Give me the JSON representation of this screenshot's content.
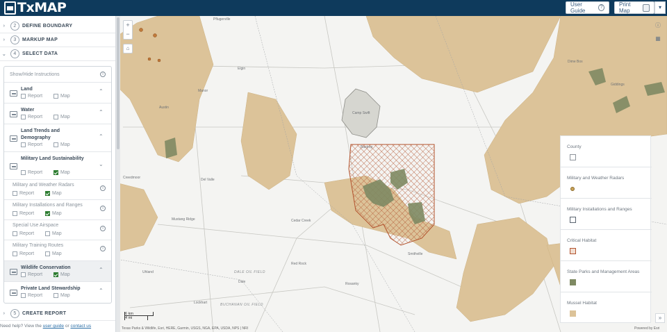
{
  "header": {
    "app_name": "TxMAP",
    "user_guide_label": "User Guide",
    "print_map_label": "Print Map",
    "help_icon_glyph": "?",
    "dropdown_glyph": "▾",
    "bg_color": "#0e3a5c"
  },
  "steps": [
    {
      "num": "2",
      "label": "DEFINE BOUNDARY",
      "chev": "›"
    },
    {
      "num": "3",
      "label": "MARKUP MAP",
      "chev": "›"
    },
    {
      "num": "4",
      "label": "SELECT DATA",
      "chev": "⌄"
    },
    {
      "num": "5",
      "label": "CREATE REPORT",
      "chev": "›"
    }
  ],
  "panel": {
    "instructions_label": "Show/Hide Instructions",
    "info_glyph": "i",
    "report_label": "Report",
    "map_label": "Map",
    "categories": [
      {
        "title": "Land",
        "report": false,
        "map": false,
        "chev": "⌃"
      },
      {
        "title": "Water",
        "report": false,
        "map": false,
        "chev": "⌃"
      },
      {
        "title": "Land Trends and Demography",
        "report": false,
        "map": false,
        "chev": "⌃"
      },
      {
        "title": "Military Land Sustainability",
        "report": false,
        "map": true,
        "chev": "⌄"
      },
      {
        "title": "Wildlife Conservation",
        "report": false,
        "map": true,
        "chev": "⌃"
      },
      {
        "title": "Private Land Stewardship",
        "report": false,
        "map": false,
        "chev": "⌃"
      }
    ],
    "sublayers": [
      {
        "title": "Military and Weather Radars",
        "report": false,
        "map": true
      },
      {
        "title": "Military Installations and Ranges",
        "report": false,
        "map": true
      },
      {
        "title": "Special Use Airspace",
        "report": false,
        "map": false
      },
      {
        "title": "Military Training Routes",
        "report": false,
        "map": false
      }
    ]
  },
  "help": {
    "prefix": "Need help? View the",
    "guide_link": "user guide",
    "or": "or",
    "contact_link": "contact us"
  },
  "map": {
    "zoom_in": "+",
    "zoom_out": "−",
    "home_icon": "⌂",
    "info_icon": "ⓘ",
    "grid_icon": "▦",
    "expand_icon": "»",
    "labels": [
      {
        "text": "Pflugerville",
        "cls": ""
      },
      {
        "text": "Elgin",
        "cls": ""
      },
      {
        "text": "Austin",
        "cls": ""
      },
      {
        "text": "Manor",
        "cls": ""
      },
      {
        "text": "Camp Swift",
        "cls": ""
      },
      {
        "text": "Dime Box",
        "cls": ""
      },
      {
        "text": "Giddings",
        "cls": ""
      },
      {
        "text": "Bastrop",
        "cls": ""
      },
      {
        "text": "Cedar Creek",
        "cls": ""
      },
      {
        "text": "Smithville",
        "cls": ""
      },
      {
        "text": "Red Rock",
        "cls": ""
      },
      {
        "text": "Lockhart",
        "cls": ""
      },
      {
        "text": "Dale",
        "cls": ""
      },
      {
        "text": "Rosanky",
        "cls": ""
      },
      {
        "text": "Mustang Ridge",
        "cls": ""
      },
      {
        "text": "DALE OIL FIELD",
        "cls": "it"
      },
      {
        "text": "BUCHANAN OIL FIELD",
        "cls": "it"
      },
      {
        "text": "Uhland",
        "cls": ""
      },
      {
        "text": "Del Valle",
        "cls": ""
      },
      {
        "text": "Creedmoor",
        "cls": ""
      }
    ],
    "scale_km": "6 km",
    "scale_mi": "4 mi",
    "attribution": "Texas Parks & Wildlife, Esri, HERE, Garmin, USGS, NGA, EPA, USDA, NPS | NRI",
    "powered_by": "Powered by Esri"
  },
  "legend": [
    {
      "title": "County",
      "swatch": "county"
    },
    {
      "title": "Military and Weather Radars",
      "swatch": "radar"
    },
    {
      "title": "Military Installations and Ranges",
      "swatch": "install"
    },
    {
      "title": "Critical Habitat",
      "swatch": "critical"
    },
    {
      "title": "State Parks and Management Areas",
      "swatch": "parks"
    },
    {
      "title": "Mussel Habitat",
      "swatch": "mussel"
    }
  ],
  "colors": {
    "mussel": "#dcc399",
    "critical": "#b3542f",
    "parks": "#7f8a63",
    "install": "#d6d6d0"
  }
}
